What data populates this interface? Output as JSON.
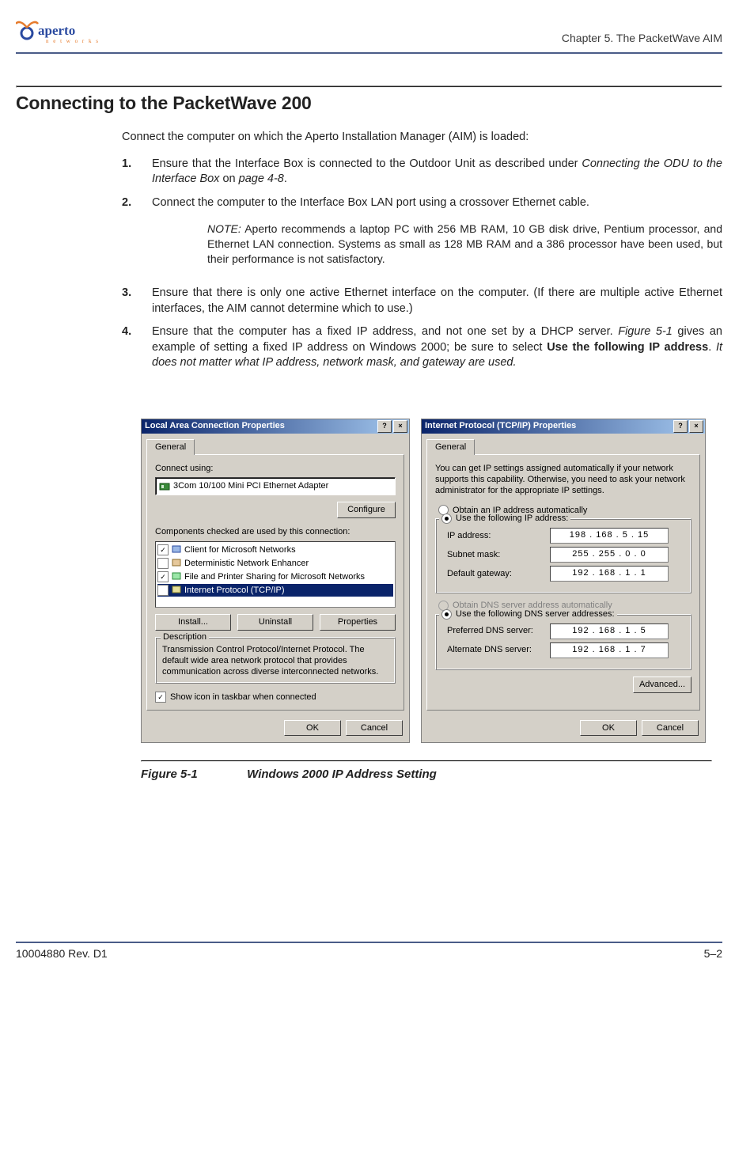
{
  "header": {
    "logo_text": "aperto",
    "logo_sub": "networks",
    "chapter": "Chapter 5.  The PacketWave AIM"
  },
  "section_title": "Connecting to the PacketWave 200",
  "intro": "Connect the computer on which the Aperto Installation Manager (AIM) is loaded:",
  "steps": {
    "s1_num": "1.",
    "s1_a": "Ensure that the Interface Box is connected to the Outdoor Unit as described under ",
    "s1_b": "Connecting the ODU to the Interface Box",
    "s1_c": " on ",
    "s1_d": "page 4-8",
    "s1_e": ".",
    "s2_num": "2.",
    "s2": "Connect the computer to the Interface Box LAN port using a crossover Ethernet cable.",
    "note_label": "NOTE:",
    "note_body": "  Aperto recommends a laptop PC with 256 MB RAM, 10 GB disk drive, Pentium processor, and Ethernet LAN connection. Systems as small as 128 MB RAM and a 386 processor have been used, but their performance is not satisfactory.",
    "s3_num": "3.",
    "s3": "Ensure that there is only one active Ethernet interface on the computer. (If there are multiple active Ethernet interfaces, the AIM cannot determine which to use.)",
    "s4_num": "4.",
    "s4_a": "Ensure that the computer has a fixed IP address, and not one set by a DHCP server. ",
    "s4_b": "Figure 5-1",
    "s4_c": " gives an example of setting a fixed IP address on Windows 2000; be sure to select ",
    "s4_d": "Use the following IP address",
    "s4_e": ". ",
    "s4_f": "It does not matter what IP address, network mask, and gateway are used."
  },
  "dlg_left": {
    "title": "Local Area Connection Properties",
    "tab": "General",
    "connect_using": "Connect using:",
    "adapter": "3Com 10/100 Mini PCI Ethernet Adapter",
    "configure": "Configure",
    "components_label": "Components checked are used by this connection:",
    "comp1": "Client for Microsoft Networks",
    "comp2": "Deterministic Network Enhancer",
    "comp3": "File and Printer Sharing for Microsoft Networks",
    "comp4": "Internet Protocol (TCP/IP)",
    "install": "Install...",
    "uninstall": "Uninstall",
    "properties": "Properties",
    "desc_label": "Description",
    "desc": "Transmission Control Protocol/Internet Protocol. The default wide area network protocol that provides communication across diverse interconnected networks.",
    "show_icon": "Show icon in taskbar when connected",
    "ok": "OK",
    "cancel": "Cancel"
  },
  "dlg_right": {
    "title": "Internet Protocol (TCP/IP) Properties",
    "tab": "General",
    "info": "You can get IP settings assigned automatically if your network supports this capability. Otherwise, you need to ask your network administrator for the appropriate IP settings.",
    "r_auto_ip": "Obtain an IP address automatically",
    "r_use_ip": "Use the following IP address:",
    "ip_label": "IP address:",
    "ip_val": "198 . 168 .   5   .  15",
    "mask_label": "Subnet mask:",
    "mask_val": "255 . 255 .   0   .   0",
    "gw_label": "Default gateway:",
    "gw_val": "192 . 168 .   1   .   1",
    "r_auto_dns": "Obtain DNS server address automatically",
    "r_use_dns": "Use the following DNS server addresses:",
    "dns1_label": "Preferred DNS server:",
    "dns1_val": "192 . 168 .   1   .   5",
    "dns2_label": "Alternate DNS server:",
    "dns2_val": "192 . 168 .   1   .   7",
    "advanced": "Advanced...",
    "ok": "OK",
    "cancel": "Cancel"
  },
  "figure": {
    "num": "Figure 5-1",
    "title": "Windows 2000 IP Address Setting"
  },
  "footer": {
    "left": "10004880 Rev. D1",
    "right": "5–2"
  }
}
